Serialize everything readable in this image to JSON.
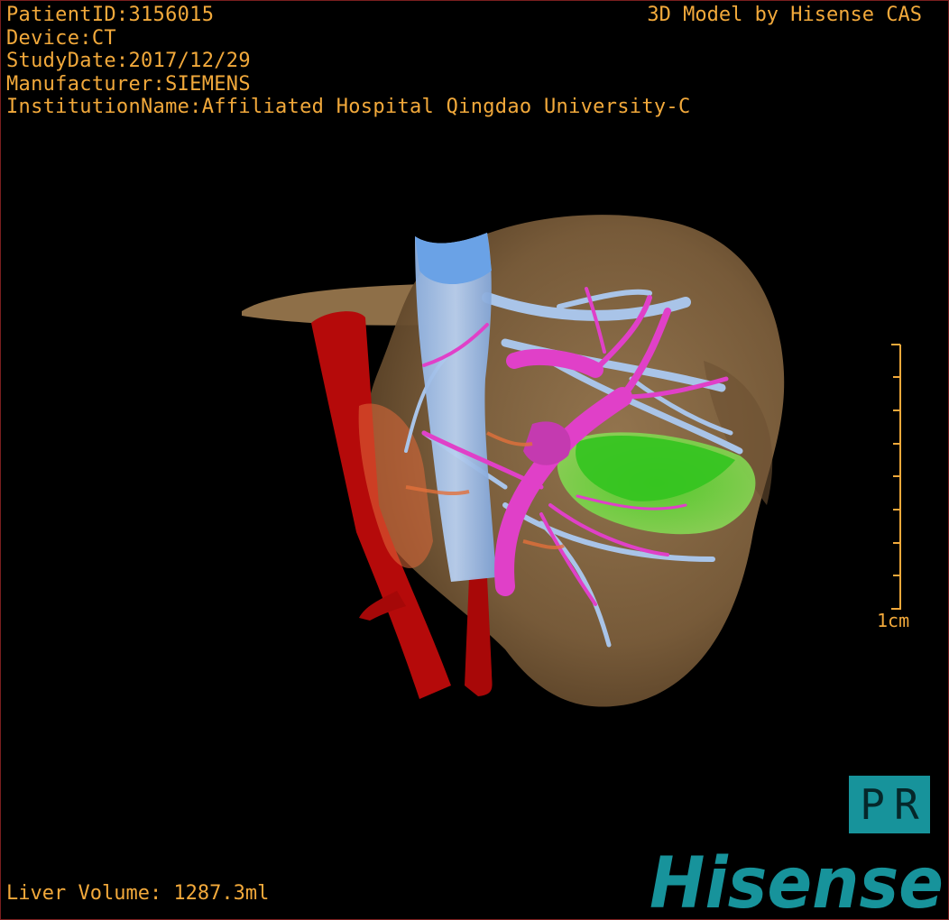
{
  "header": {
    "patient_id": "PatientID:3156015",
    "device": "Device:CT",
    "study_date": "StudyDate:2017/12/29",
    "manufacturer": "Manufacturer:SIEMENS",
    "institution": "InstitutionName:Affiliated Hospital Qingdao University-C"
  },
  "brand_caption": "3D Model by Hisense CAS",
  "footer": {
    "liver_volume": "Liver Volume: 1287.3ml"
  },
  "scale_bar": {
    "label": "1cm",
    "ticks": 9
  },
  "view_toggle": {
    "left": "P",
    "right": "R"
  },
  "logo": {
    "text": "Hisense",
    "color": "#17939b"
  },
  "colors": {
    "overlay_text": "#f2a93b",
    "liver": "#8a6a43",
    "hepatic_vein": "#a9c4e8",
    "portal_vein": "#e040c8",
    "artery": "#c00000",
    "lesion": "#6ee03a"
  }
}
